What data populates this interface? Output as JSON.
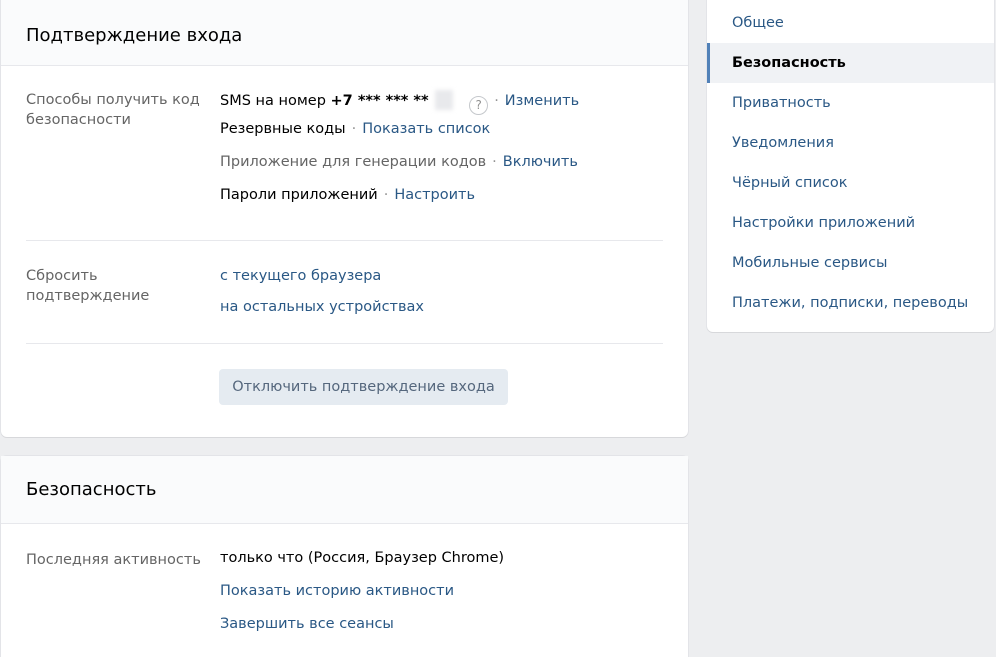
{
  "login_confirm": {
    "title": "Подтверждение входа",
    "methods_label": "Способы получить код безопасности",
    "sms_prefix": "SMS на номер",
    "sms_number": "+7 *** *** **",
    "help_glyph": "?",
    "sms_action": "Изменить",
    "backup_label": "Резервные коды",
    "backup_action": "Показать список",
    "app_label": "Приложение для генерации кодов",
    "app_action": "Включить",
    "passwords_label": "Пароли приложений",
    "passwords_action": "Настроить",
    "reset_label": "Сбросить подтверждение",
    "reset_current": "с текущего браузера",
    "reset_others": "на остальных устройствах",
    "disable_button": "Отключить подтверждение входа"
  },
  "security": {
    "title": "Безопасность",
    "last_activity_label": "Последняя активность",
    "last_activity_value": "только что (Россия, Браузер Chrome)",
    "history_link": "Показать историю активности",
    "end_sessions_link": "Завершить все сеансы"
  },
  "menu": {
    "items": [
      {
        "label": "Общее"
      },
      {
        "label": "Безопасность"
      },
      {
        "label": "Приватность"
      },
      {
        "label": "Уведомления"
      },
      {
        "label": "Чёрный список"
      },
      {
        "label": "Настройки приложений"
      },
      {
        "label": "Мобильные сервисы"
      },
      {
        "label": "Платежи, подписки, переводы"
      }
    ],
    "active_index": 1
  },
  "colors": {
    "link": "#2a5885",
    "accent": "#5181b8",
    "background": "#edeef0"
  }
}
